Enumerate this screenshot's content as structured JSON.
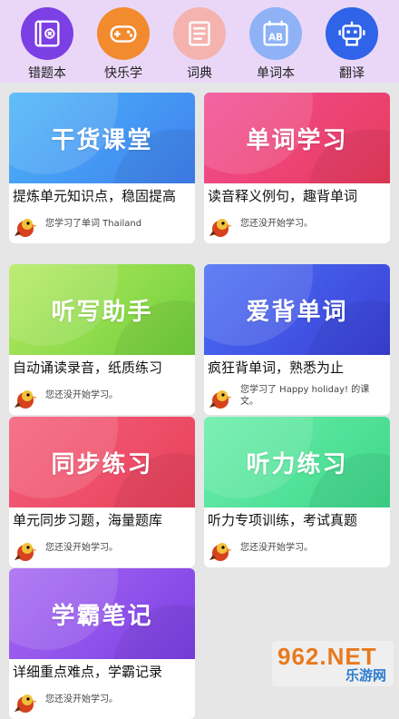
{
  "nav": [
    {
      "label": "错题本",
      "icon": "notebook-x-icon",
      "color": "#7b3fe4"
    },
    {
      "label": "快乐学",
      "icon": "gamepad-icon",
      "color": "#f28a2e"
    },
    {
      "label": "词典",
      "icon": "dictionary-book-icon",
      "color": "#f5b3b0"
    },
    {
      "label": "单词本",
      "icon": "calendar-ab-icon",
      "color": "#8fb2f7"
    },
    {
      "label": "翻译",
      "icon": "robot-icon",
      "color": "#2f63e8"
    }
  ],
  "cards": [
    {
      "title": "干货课堂",
      "desc": "提炼单元知识点，稳固提高",
      "progress": "您学习了单词 Thailand",
      "colors": [
        "#41a8f5",
        "#3f7ff0"
      ]
    },
    {
      "title": "单词学习",
      "desc": "读音释义例句，趣背单词",
      "progress": "您还没开始学习。",
      "colors": [
        "#f04a8a",
        "#e83c5e"
      ]
    },
    {
      "title": "听写助手",
      "desc": "自动诵读录音，纸质练习",
      "progress": "您还没开始学习。",
      "colors": [
        "#a9e35a",
        "#6fcf3a"
      ]
    },
    {
      "title": "爱背单词",
      "desc": "疯狂背单词，熟悉为止",
      "progress": "您学习了 Happy holiday! 的课文。",
      "colors": [
        "#4266f2",
        "#3a3fd6"
      ]
    },
    {
      "title": "同步练习",
      "desc": "单元同步习题，海量题库",
      "progress": "您还没开始学习。",
      "colors": [
        "#f2566e",
        "#e8405b"
      ]
    },
    {
      "title": "听力练习",
      "desc": "听力专项训练，考试真题",
      "progress": "您还没开始学习。",
      "colors": [
        "#5ce8a2",
        "#3fd78a"
      ]
    },
    {
      "title": "学霸笔记",
      "desc": "详细重点难点，学霸记录",
      "progress": "您还没开始学习。",
      "colors": [
        "#a05cf0",
        "#7b3fe4"
      ]
    }
  ],
  "watermark": {
    "main": "962.NET",
    "sub": "乐游网"
  }
}
